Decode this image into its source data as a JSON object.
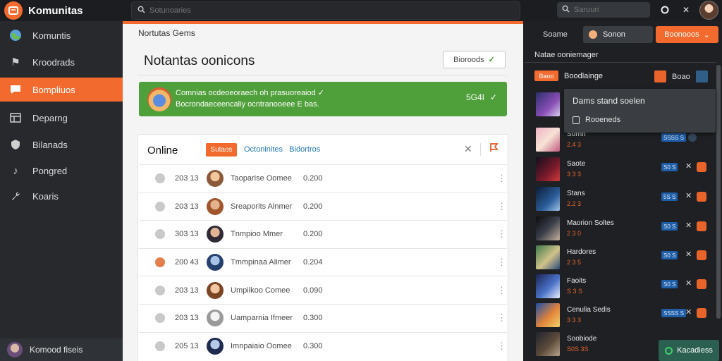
{
  "app": {
    "name": "Komunitas",
    "search_placeholder": "Sotunoaries",
    "right_search_placeholder": "Saruuri"
  },
  "sidebar": {
    "items": [
      {
        "label": "Komuntis",
        "icon": "globe-icon"
      },
      {
        "label": "Kroodrads",
        "icon": "flag-icon"
      },
      {
        "label": "Bompliuos",
        "icon": "comment-icon",
        "active": true
      },
      {
        "label": "Deparng",
        "icon": "table-icon"
      },
      {
        "label": "Bilanads",
        "icon": "shield-icon"
      },
      {
        "label": "Pongred",
        "icon": "music-icon"
      },
      {
        "label": "Koaris",
        "icon": "wrench-icon"
      }
    ],
    "user": {
      "name": "Komood fiseis"
    }
  },
  "main": {
    "section_label": "Nortutas Gems",
    "title": "Notantas oonicons",
    "header_button": "Bioroods",
    "banner": {
      "line1": "Comnias ocdeoeoraech oh prasuoreaiod ✓",
      "line2": "Bocrondaeceencaliy ocntranooeee E bas.",
      "right_text": "5G4I"
    },
    "online": {
      "title": "Online",
      "chip": "Sutaos",
      "tabs": [
        "Octoninites",
        "Bidortros"
      ],
      "rows": [
        {
          "num": "203 13",
          "name": "Taoparise Oomee",
          "value": "0.200"
        },
        {
          "num": "203 13",
          "name": "Sreaporits Alnmer",
          "value": "0.200"
        },
        {
          "num": "303 13",
          "name": "Tnmpioo Mmer",
          "value": "0.200"
        },
        {
          "num": "200 43",
          "name": "Tmmpinaa Alimer",
          "value": "0.204"
        },
        {
          "num": "203 13",
          "name": "Umpiikoo Comee",
          "value": "0.090"
        },
        {
          "num": "203 13",
          "name": "Uamparnia Ifmeer",
          "value": "0.300"
        },
        {
          "num": "205 13",
          "name": "Imnpaiaio Oomee",
          "value": "0.300"
        }
      ]
    }
  },
  "right_panel": {
    "tab1": "Soame",
    "tab2": "Sonon",
    "tab3": "Boonooos",
    "heading": "Natae ooniemager",
    "sub_label": "Boodlainge",
    "sub_chip": "Baoo",
    "sub_button": "Boao",
    "dropdown": {
      "title": "Dams stand soelen",
      "option": "Rooeneds"
    },
    "games": [
      {
        "name": "",
        "sub": ""
      },
      {
        "name": "Sornh",
        "sub": "2.4 3",
        "badge": "SSSS S"
      },
      {
        "name": "Saote",
        "sub": "3 3 3",
        "badge": "S0 S"
      },
      {
        "name": "Stans",
        "sub": "2.2 3",
        "badge": "5S S"
      },
      {
        "name": "Maorion Soltes",
        "sub": "2 3 0",
        "badge": "S0 S"
      },
      {
        "name": "Hardores",
        "sub": "2 3 5",
        "badge": "S0 S"
      },
      {
        "name": "Faoits",
        "sub": "S 3 S",
        "badge": "S0 S"
      },
      {
        "name": "Cenulia Sedis",
        "sub": "3 3 3",
        "badge": "SSSS S"
      },
      {
        "name": "Soobiode",
        "sub": "S0S 3S",
        "badge": ""
      }
    ],
    "footer_button": "Kacadiess"
  }
}
